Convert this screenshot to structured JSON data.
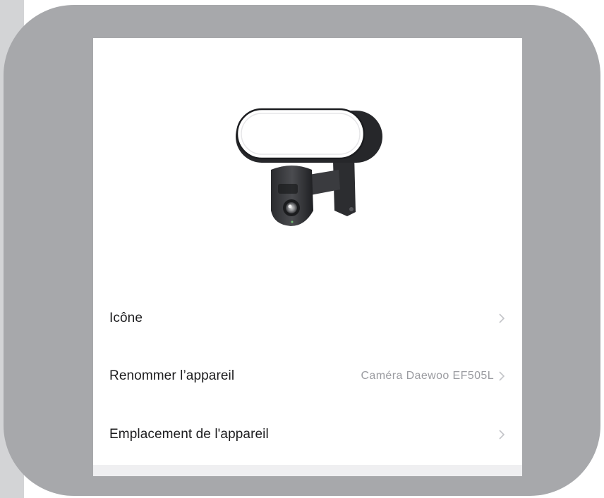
{
  "settings": {
    "items": [
      {
        "label": "Icône",
        "value": "",
        "icon": "chevron-right-icon"
      },
      {
        "label": "Renommer l’appareil",
        "value": "Caméra Daewoo EF505L",
        "icon": "chevron-right-icon"
      },
      {
        "label": "Emplacement de l'appareil",
        "value": "",
        "icon": "chevron-right-icon"
      }
    ]
  },
  "colors": {
    "frame": "#a7a8ab",
    "left_strip": "#d3d4d6",
    "screen_bg": "#ffffff",
    "label_text": "#1c1c1e",
    "value_text": "#9a9ba0",
    "chevron": "#c3c4c8"
  }
}
